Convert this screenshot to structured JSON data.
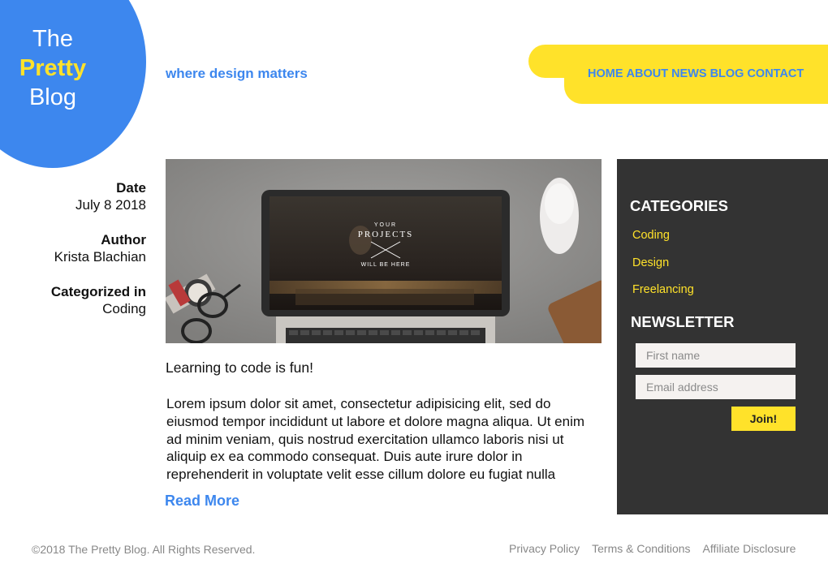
{
  "logo": {
    "line1": "The",
    "line2": "Pretty",
    "line3": "Blog"
  },
  "tagline": "where design matters",
  "nav": [
    "HOME",
    "ABOUT",
    "NEWS",
    "BLOG",
    "CONTACT"
  ],
  "meta": {
    "date_label": "Date",
    "date": "July 8 2018",
    "author_label": "Author",
    "author": "Krista Blachian",
    "category_label": "Categorized in",
    "category": "Coding"
  },
  "hero": {
    "screen_text_1": "YOUR",
    "screen_text_2": "PROJECTS",
    "screen_text_3": "WILL BE HERE"
  },
  "post": {
    "title": "Learning to code is fun!",
    "body": "Lorem ipsum dolor sit amet, consectetur adipisicing elit, sed do eiusmod tempor incididunt ut labore et dolore magna aliqua. Ut enim ad minim veniam, quis nostrud exercitation ullamco laboris nisi ut aliquip ex ea commodo consequat. Duis aute irure dolor in reprehenderit in voluptate velit esse cillum dolore eu fugiat nulla",
    "read_more": "Read More"
  },
  "sidebar": {
    "categories_title": "CATEGORIES",
    "categories": [
      "Coding",
      "Design",
      "Freelancing"
    ],
    "newsletter_title": "NEWSLETTER",
    "first_name_placeholder": "First name",
    "email_placeholder": "Email address",
    "join_label": "Join!"
  },
  "footer": {
    "copyright": "©2018 The Pretty Blog. All Rights Reserved.",
    "links": [
      "Privacy Policy",
      "Terms & Conditions",
      "Affiliate Disclosure"
    ]
  },
  "colors": {
    "brand_blue": "#3d87ee",
    "brand_yellow": "#ffe22a",
    "sidebar_bg": "#333333"
  }
}
